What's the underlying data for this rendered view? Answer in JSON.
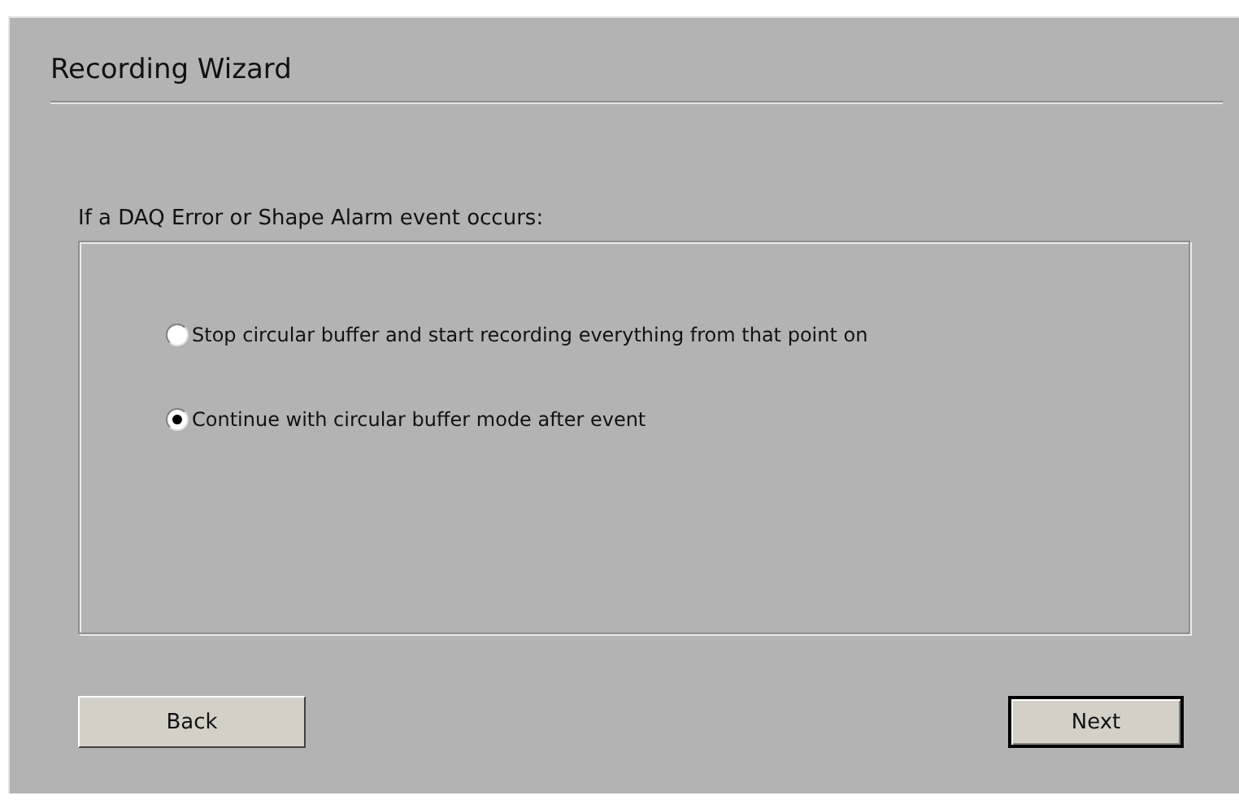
{
  "window": {
    "title": "Recording Wizard"
  },
  "prompt": "If a DAQ Error or Shape Alarm event occurs:",
  "options": [
    {
      "label": "Stop circular buffer and start recording everything from that point on",
      "selected": false
    },
    {
      "label": "Continue with circular buffer mode after event",
      "selected": true
    }
  ],
  "buttons": [
    {
      "label": "Back",
      "default": false
    },
    {
      "label": "Next",
      "default": true
    }
  ]
}
